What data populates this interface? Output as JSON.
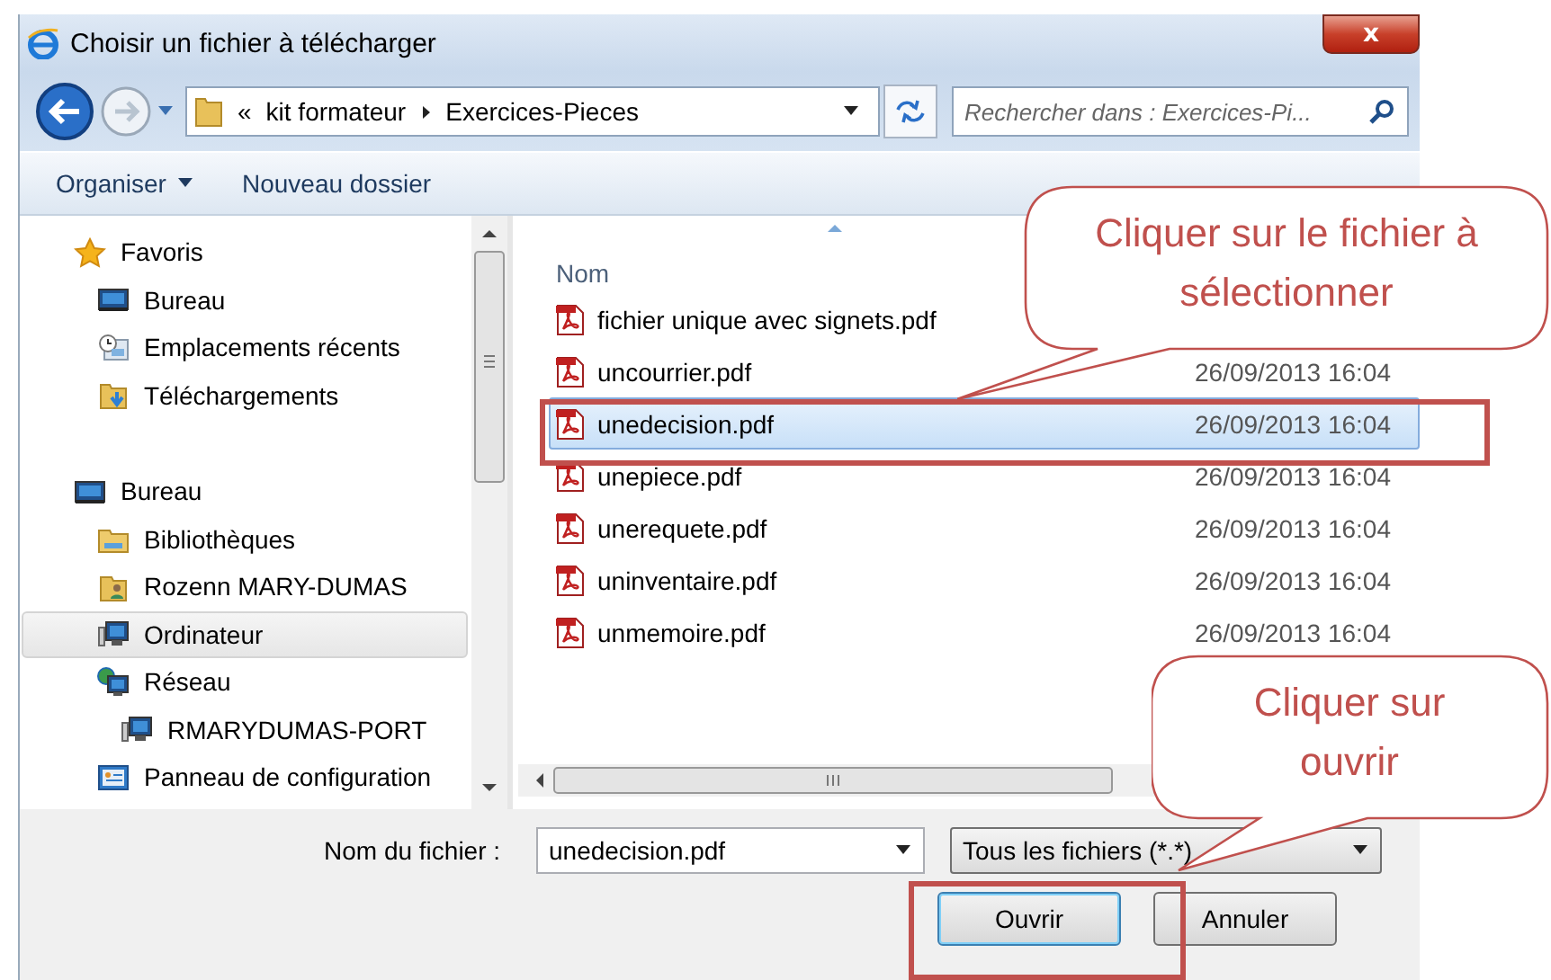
{
  "window": {
    "title": "Choisir un fichier à télécharger",
    "close": "x"
  },
  "address": {
    "prefix": "«",
    "crumbs": [
      "kit formateur",
      "Exercices-Pieces"
    ]
  },
  "search": {
    "placeholder": "Rechercher dans : Exercices-Pi..."
  },
  "toolbar": [
    {
      "label": "Organiser",
      "dropdown": true
    },
    {
      "label": "Nouveau dossier",
      "dropdown": false
    }
  ],
  "sidebar": {
    "items": [
      {
        "label": "Favoris",
        "kind": "star",
        "selected": false,
        "children": [
          {
            "label": "Bureau",
            "kind": "desktop",
            "selected": false
          },
          {
            "label": "Emplacements récents",
            "kind": "recent",
            "selected": false
          },
          {
            "label": "Téléchargements",
            "kind": "download",
            "selected": false
          }
        ]
      },
      {
        "label": "Bureau",
        "kind": "desktop",
        "selected": false,
        "children": [
          {
            "label": "Bibliothèques",
            "kind": "library",
            "selected": false
          },
          {
            "label": "Rozenn MARY-DUMAS",
            "kind": "user",
            "selected": false
          },
          {
            "label": "Ordinateur",
            "kind": "computer",
            "selected": false,
            "highlighted": true
          },
          {
            "label": "Réseau",
            "kind": "network",
            "selected": false,
            "children": [
              {
                "label": "RMARYDUMAS-PORT",
                "kind": "computer",
                "selected": false
              }
            ]
          },
          {
            "label": "Panneau de configuration",
            "kind": "panel",
            "selected": false
          }
        ]
      }
    ]
  },
  "files": {
    "columns": [
      "Nom"
    ],
    "rows": [
      {
        "name": "fichier unique avec signets.pdf",
        "selected": false
      },
      {
        "name": "uncourrier.pdf",
        "date": "26/09/2013 16:04",
        "selected": false
      },
      {
        "name": "unedecision.pdf",
        "date": "26/09/2013 16:04",
        "selected": true
      },
      {
        "name": "unepiece.pdf",
        "date": "26/09/2013 16:04",
        "selected": false
      },
      {
        "name": "unerequete.pdf",
        "date": "26/09/2013 16:04",
        "selected": false
      },
      {
        "name": "uninventaire.pdf",
        "date": "26/09/2013 16:04",
        "selected": false
      },
      {
        "name": "unmemoire.pdf",
        "date": "26/09/2013 16:04",
        "selected": false
      }
    ]
  },
  "footer": {
    "filename_label": "Nom du fichier :",
    "filename": "unedecision.pdf",
    "filter": "Tous les fichiers (*.*)",
    "buttons": [
      {
        "label": "Ouvrir",
        "default": true
      },
      {
        "label": "Annuler",
        "default": false
      }
    ]
  },
  "annotations": [
    {
      "kind": "callout",
      "text": "Cliquer sur le fichier à sélectionner"
    },
    {
      "kind": "callout",
      "text": "Cliquer sur ouvrir"
    }
  ]
}
